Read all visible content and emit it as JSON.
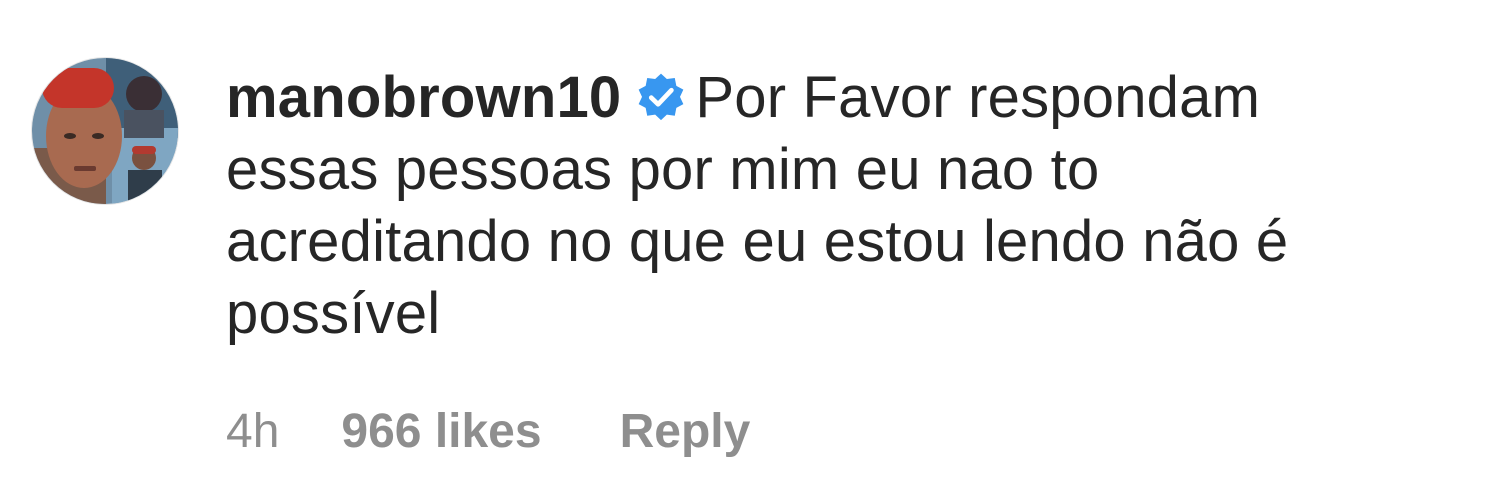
{
  "comment": {
    "username": "manobrown10",
    "verified": true,
    "lines": [
      "Por Favor respondam",
      "essas pessoas por mim eu nao to",
      "acreditando no que eu estou lendo não é",
      "possível"
    ],
    "time": "4h",
    "likes": "966 likes",
    "reply_label": "Reply"
  },
  "colors": {
    "text": "#262626",
    "meta": "#8e8e8e",
    "verified_badge": "#3897f0"
  },
  "icons": {
    "verified": "verified-badge-icon",
    "avatar": "profile-avatar"
  }
}
